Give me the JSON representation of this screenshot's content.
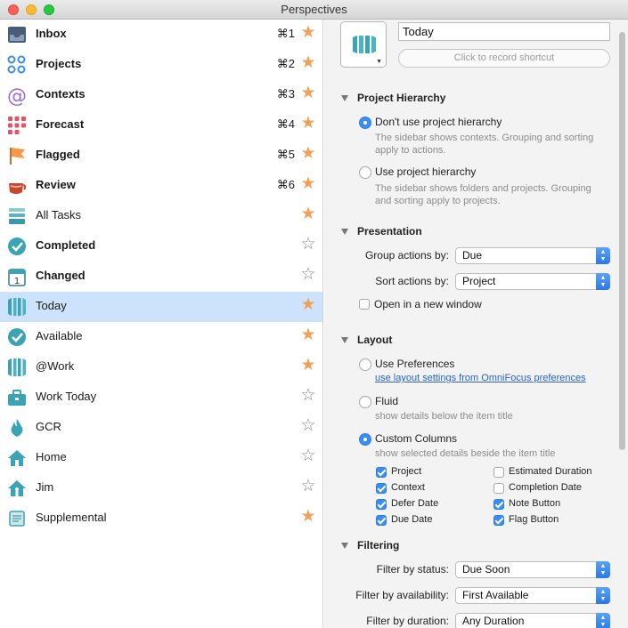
{
  "window": {
    "title": "Perspectives"
  },
  "sidebar": {
    "items": [
      {
        "label": "Inbox",
        "bold": true,
        "shortcut": "⌘1",
        "starred": true,
        "icon": "inbox-icon"
      },
      {
        "label": "Projects",
        "bold": true,
        "shortcut": "⌘2",
        "starred": true,
        "icon": "projects-icon"
      },
      {
        "label": "Contexts",
        "bold": true,
        "shortcut": "⌘3",
        "starred": true,
        "icon": "contexts-icon"
      },
      {
        "label": "Forecast",
        "bold": true,
        "shortcut": "⌘4",
        "starred": true,
        "icon": "forecast-icon"
      },
      {
        "label": "Flagged",
        "bold": true,
        "shortcut": "⌘5",
        "starred": true,
        "icon": "flag-icon"
      },
      {
        "label": "Review",
        "bold": true,
        "shortcut": "⌘6",
        "starred": true,
        "icon": "review-icon"
      },
      {
        "label": "All Tasks",
        "bold": false,
        "shortcut": "",
        "starred": true,
        "icon": "all-tasks-icon"
      },
      {
        "label": "Completed",
        "bold": true,
        "shortcut": "",
        "starred": false,
        "icon": "completed-icon"
      },
      {
        "label": "Changed",
        "bold": true,
        "shortcut": "",
        "starred": false,
        "icon": "calendar-icon"
      },
      {
        "label": "Today",
        "bold": false,
        "shortcut": "",
        "starred": true,
        "icon": "columns-icon",
        "selected": true
      },
      {
        "label": "Available",
        "bold": false,
        "shortcut": "",
        "starred": true,
        "icon": "checkmark-icon"
      },
      {
        "label": "@Work",
        "bold": false,
        "shortcut": "",
        "starred": true,
        "icon": "columns-icon"
      },
      {
        "label": "Work Today",
        "bold": false,
        "shortcut": "",
        "starred": false,
        "icon": "briefcase-icon"
      },
      {
        "label": "GCR",
        "bold": false,
        "shortcut": "",
        "starred": false,
        "icon": "flame-icon"
      },
      {
        "label": "Home",
        "bold": false,
        "shortcut": "",
        "starred": false,
        "icon": "house-icon"
      },
      {
        "label": "Jim",
        "bold": false,
        "shortcut": "",
        "starred": false,
        "icon": "house-person-icon"
      },
      {
        "label": "Supplemental",
        "bold": false,
        "shortcut": "",
        "starred": true,
        "icon": "scroll-icon"
      }
    ]
  },
  "inspector": {
    "name_value": "Today",
    "shortcut_placeholder": "Click to record shortcut",
    "hierarchy": {
      "title": "Project Hierarchy",
      "options": [
        {
          "label": "Don't use project hierarchy",
          "selected": true,
          "desc1": "The sidebar shows contexts. Grouping and sorting",
          "desc2": "apply to actions."
        },
        {
          "label": "Use project hierarchy",
          "selected": false,
          "desc1": "The sidebar shows folders and projects. Grouping",
          "desc2": "and sorting apply to projects."
        }
      ]
    },
    "presentation": {
      "title": "Presentation",
      "group_label": "Group actions by:",
      "group_value": "Due",
      "sort_label": "Sort actions by:",
      "sort_value": "Project",
      "new_window_label": "Open in a new window",
      "new_window_checked": false
    },
    "layout": {
      "title": "Layout",
      "use_prefs_label": "Use Preferences",
      "use_prefs_link": "use layout settings from OmniFocus preferences",
      "fluid_label": "Fluid",
      "fluid_desc": "show details below the item title",
      "custom_label": "Custom Columns",
      "custom_desc": "show selected details beside the item title",
      "selected": "Custom Columns",
      "columns": [
        {
          "label": "Project",
          "checked": true
        },
        {
          "label": "Estimated Duration",
          "checked": false
        },
        {
          "label": "Context",
          "checked": true
        },
        {
          "label": "Completion Date",
          "checked": false
        },
        {
          "label": "Defer Date",
          "checked": true
        },
        {
          "label": "Note Button",
          "checked": true
        },
        {
          "label": "Due Date",
          "checked": true
        },
        {
          "label": "Flag Button",
          "checked": true
        }
      ]
    },
    "filtering": {
      "title": "Filtering",
      "status_label": "Filter by status:",
      "status_value": "Due Soon",
      "availability_label": "Filter by availability:",
      "availability_value": "First Available",
      "duration_label": "Filter by duration:",
      "duration_value": "Any Duration"
    }
  },
  "colors": {
    "star_on": "#f0a057",
    "selection": "#cde3fb",
    "accent": "#3b8ef0",
    "teal_icon": "#3aa3b4"
  }
}
